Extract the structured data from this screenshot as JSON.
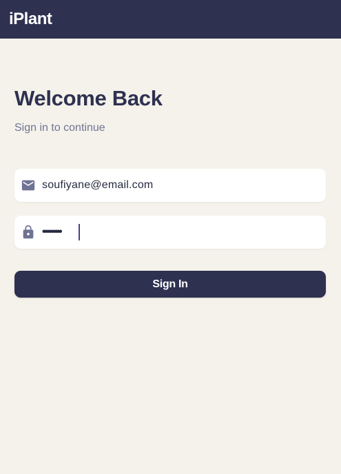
{
  "app_bar": {
    "title": "iPlant",
    "background": "#2e3150"
  },
  "login": {
    "heading": "Welcome Back",
    "subheading": "Sign in to continue",
    "email_field": {
      "icon": "mail-icon",
      "value": "soufiyane@email.com"
    },
    "password_field": {
      "icon": "lock-icon",
      "masked_value": "•••••••••",
      "focused": true
    },
    "sign_in_label": "Sign In"
  },
  "colors": {
    "page_background": "#f5f2eb",
    "primary": "#2e3150",
    "subtitle_text": "#6f7393",
    "icon": "#6f7393",
    "caret": "#4a3f8f"
  }
}
